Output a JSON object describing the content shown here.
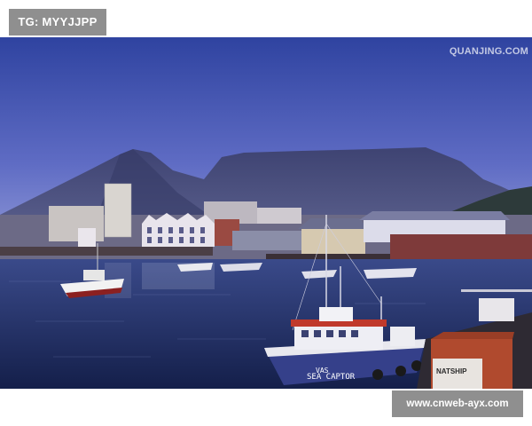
{
  "badges": {
    "tag": "TG: MYYJJPP",
    "url": "www.cnweb-ayx.com"
  },
  "photo": {
    "watermark": "QUANJING.COM",
    "boat_hull_name_1": "VAS",
    "boat_hull_name_2": "SEA CAPTOR",
    "crate_label": "NATSHIP"
  },
  "colors": {
    "sky_top": "#3b4fa8",
    "sky_bottom": "#8d97d6",
    "mountain": "#4a4f7e",
    "water": "#1f2f66",
    "boat_roof": "#c0392b",
    "crate": "#b04a2e"
  }
}
